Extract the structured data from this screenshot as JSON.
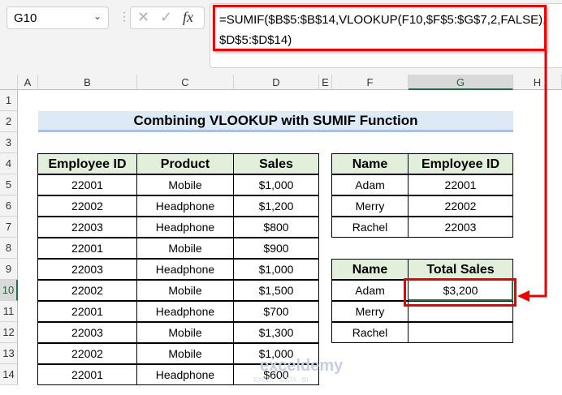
{
  "formula_bar": {
    "name_box": "G10",
    "cancel_icon": "✕",
    "enter_icon": "✓",
    "fx_label": "fx",
    "formula_line1": "=SUMIF($B$5:$B$14,VLOOKUP(F10,$F$5:$G$7,2,FALSE),",
    "formula_line2": "$D$5:$D$14)"
  },
  "columns": [
    "A",
    "B",
    "C",
    "D",
    "E",
    "F",
    "G",
    "H"
  ],
  "selected_column": "G",
  "selected_row": 10,
  "rows": [
    1,
    2,
    3,
    4,
    5,
    6,
    7,
    8,
    9,
    10,
    11,
    12,
    13,
    14
  ],
  "title": "Combining VLOOKUP with SUMIF Function",
  "main_table": {
    "headers": [
      "Employee ID",
      "Product",
      "Sales"
    ],
    "rows": [
      [
        "22001",
        "Mobile",
        "$1,000"
      ],
      [
        "22002",
        "Headphone",
        "$1,200"
      ],
      [
        "22003",
        "Headphone",
        "$800"
      ],
      [
        "22001",
        "Mobile",
        "$900"
      ],
      [
        "22003",
        "Headphone",
        "$1,000"
      ],
      [
        "22002",
        "Mobile",
        "$1,500"
      ],
      [
        "22001",
        "Headphone",
        "$700"
      ],
      [
        "22003",
        "Mobile",
        "$1,300"
      ],
      [
        "22002",
        "Mobile",
        "$1,000"
      ],
      [
        "22001",
        "Headphone",
        "$600"
      ]
    ]
  },
  "lookup_table": {
    "headers": [
      "Name",
      "Employee ID"
    ],
    "rows": [
      [
        "Adam",
        "22001"
      ],
      [
        "Merry",
        "22002"
      ],
      [
        "Rachel",
        "22003"
      ]
    ]
  },
  "result_table": {
    "headers": [
      "Name",
      "Total Sales"
    ],
    "rows": [
      [
        "Adam",
        "$3,200"
      ],
      [
        "Merry",
        ""
      ],
      [
        "Rachel",
        ""
      ]
    ]
  },
  "watermark": "exceldemy",
  "watermark_sub": "EXCEL · DATA · BI",
  "colors": {
    "accent_red": "#ee0000",
    "header_green": "#e2efda",
    "title_blue": "#dde9f5",
    "excel_green": "#217346"
  }
}
